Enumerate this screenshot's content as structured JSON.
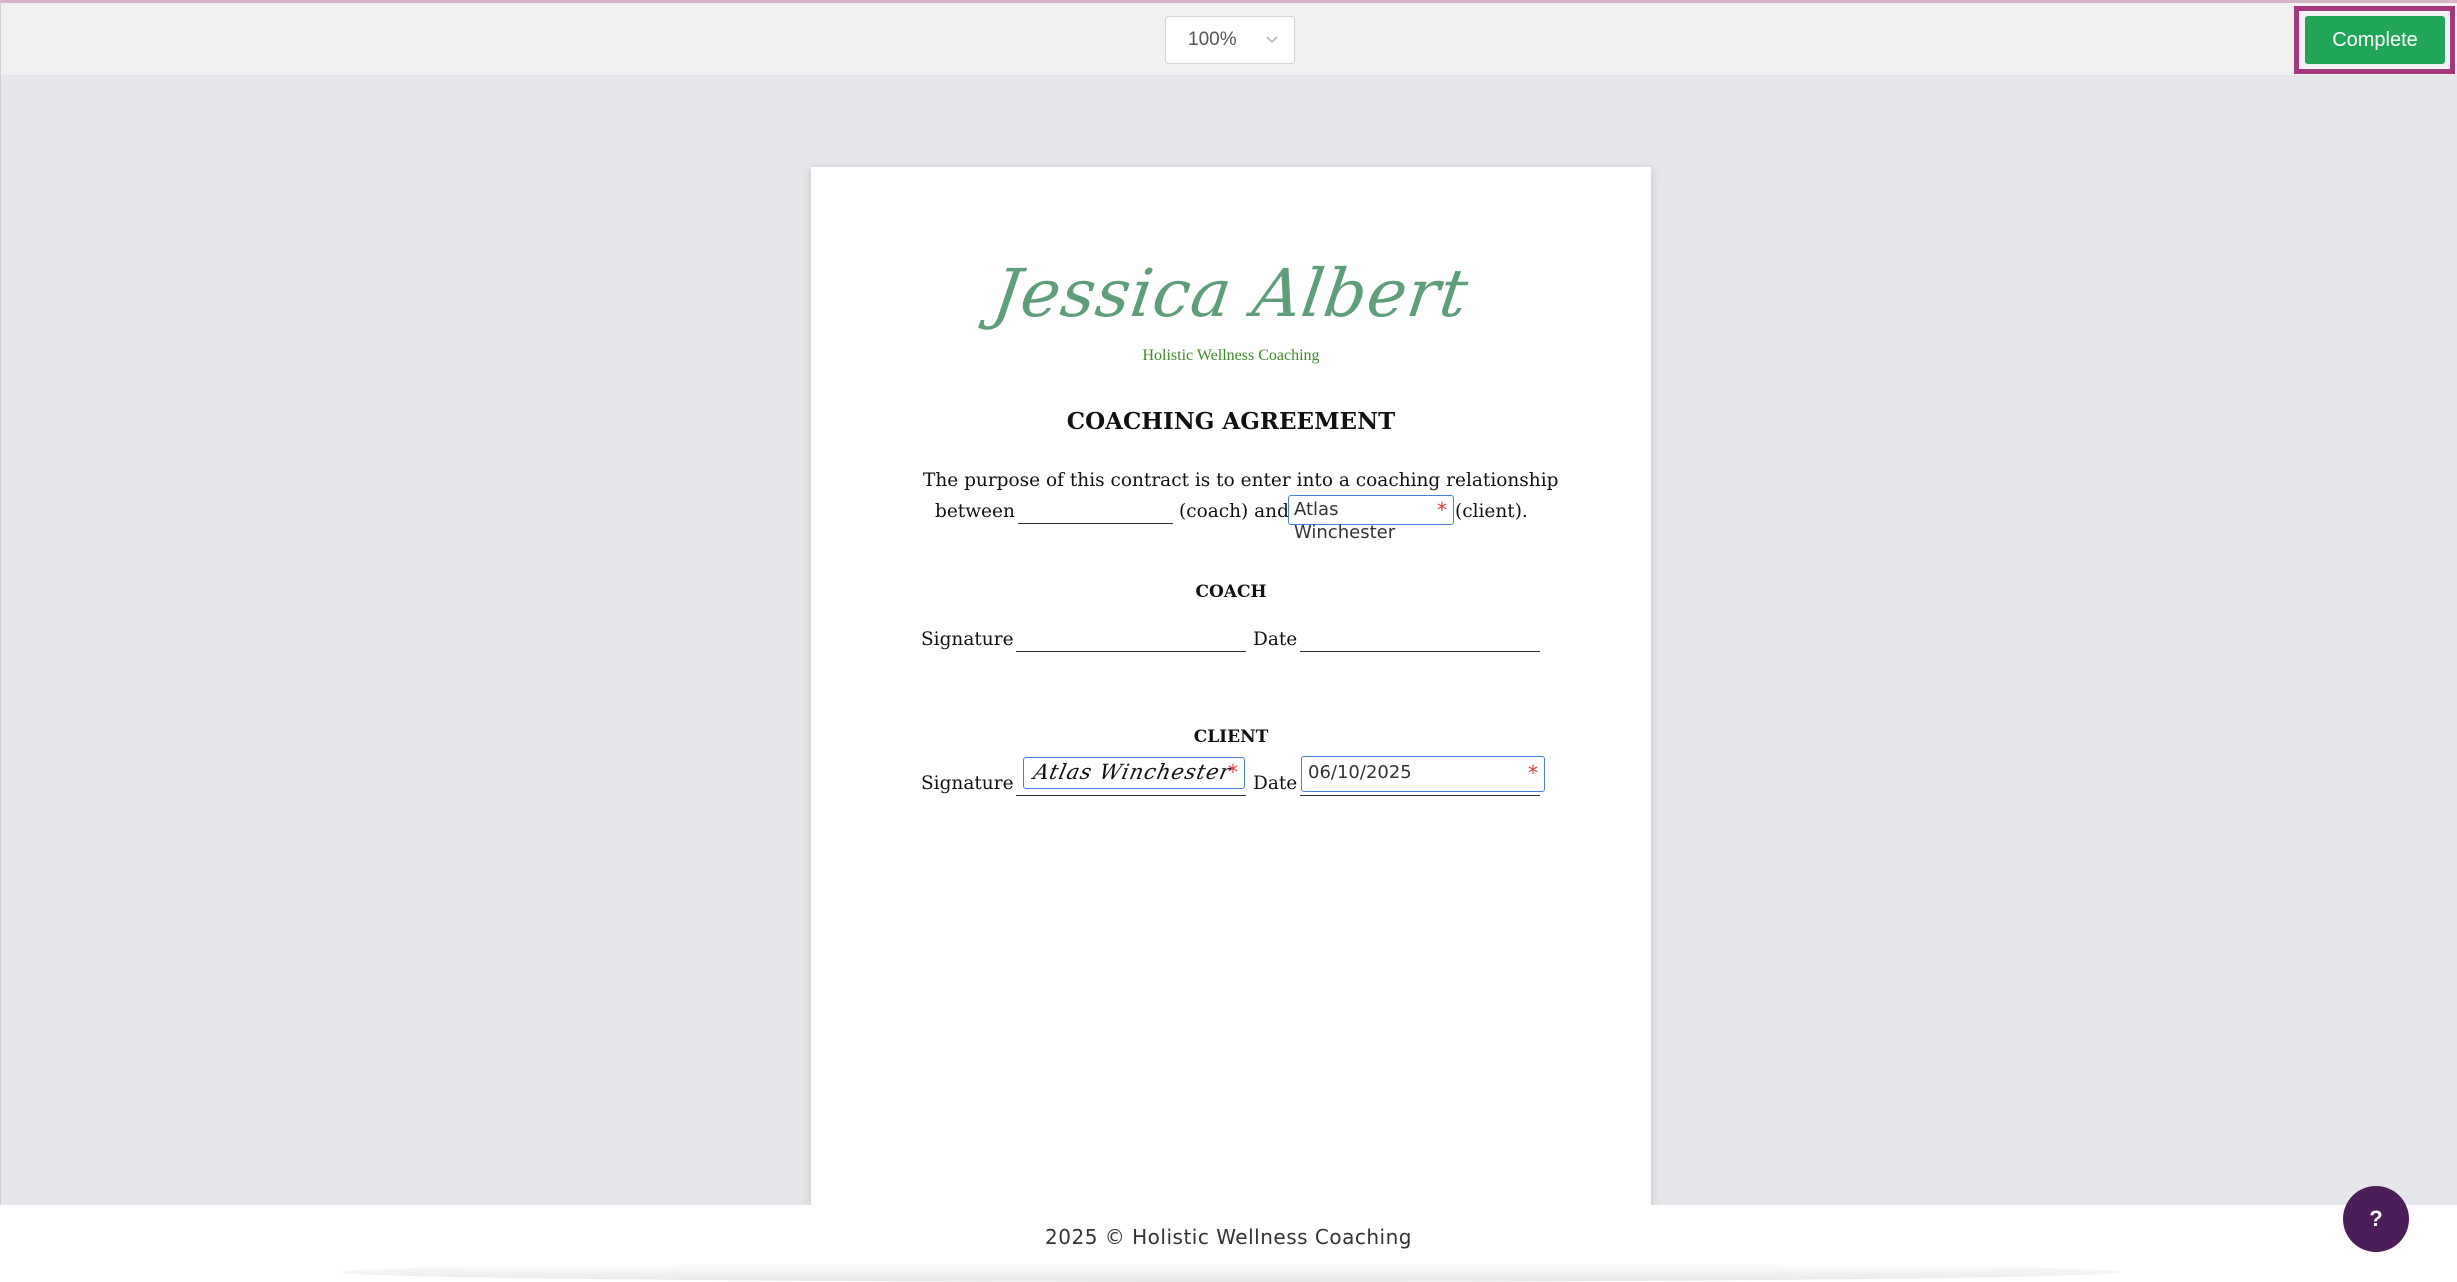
{
  "toolbar": {
    "zoom_value": "100%",
    "complete_label": "Complete"
  },
  "document": {
    "logo_script": "Jessica Albert",
    "logo_tagline": "Holistic Wellness Coaching",
    "title": "COACHING AGREEMENT",
    "purpose_line1": "The purpose of this contract is to enter into a coaching relationship",
    "purpose_between": "between",
    "purpose_coach": "(coach) and",
    "purpose_client": "(client).",
    "client_name_value_line1": "Atlas",
    "client_name_value_line2": "Winchester",
    "coach_heading": "COACH",
    "client_heading": "CLIENT",
    "signature_label": "Signature",
    "date_label": "Date",
    "client_signature_value": "Atlas Winchester",
    "client_date_value": "06/10/2025",
    "required_marker": "*"
  },
  "footer": {
    "text": "2025 © Holistic Wellness Coaching"
  },
  "help": {
    "label": "?"
  },
  "colors": {
    "complete_button": "#21a657",
    "annotation": "#a5377d",
    "field_border": "#4a7fd6",
    "required": "#d93b3b",
    "logo": "#5f9e7b",
    "help_button": "#4b1d59"
  }
}
